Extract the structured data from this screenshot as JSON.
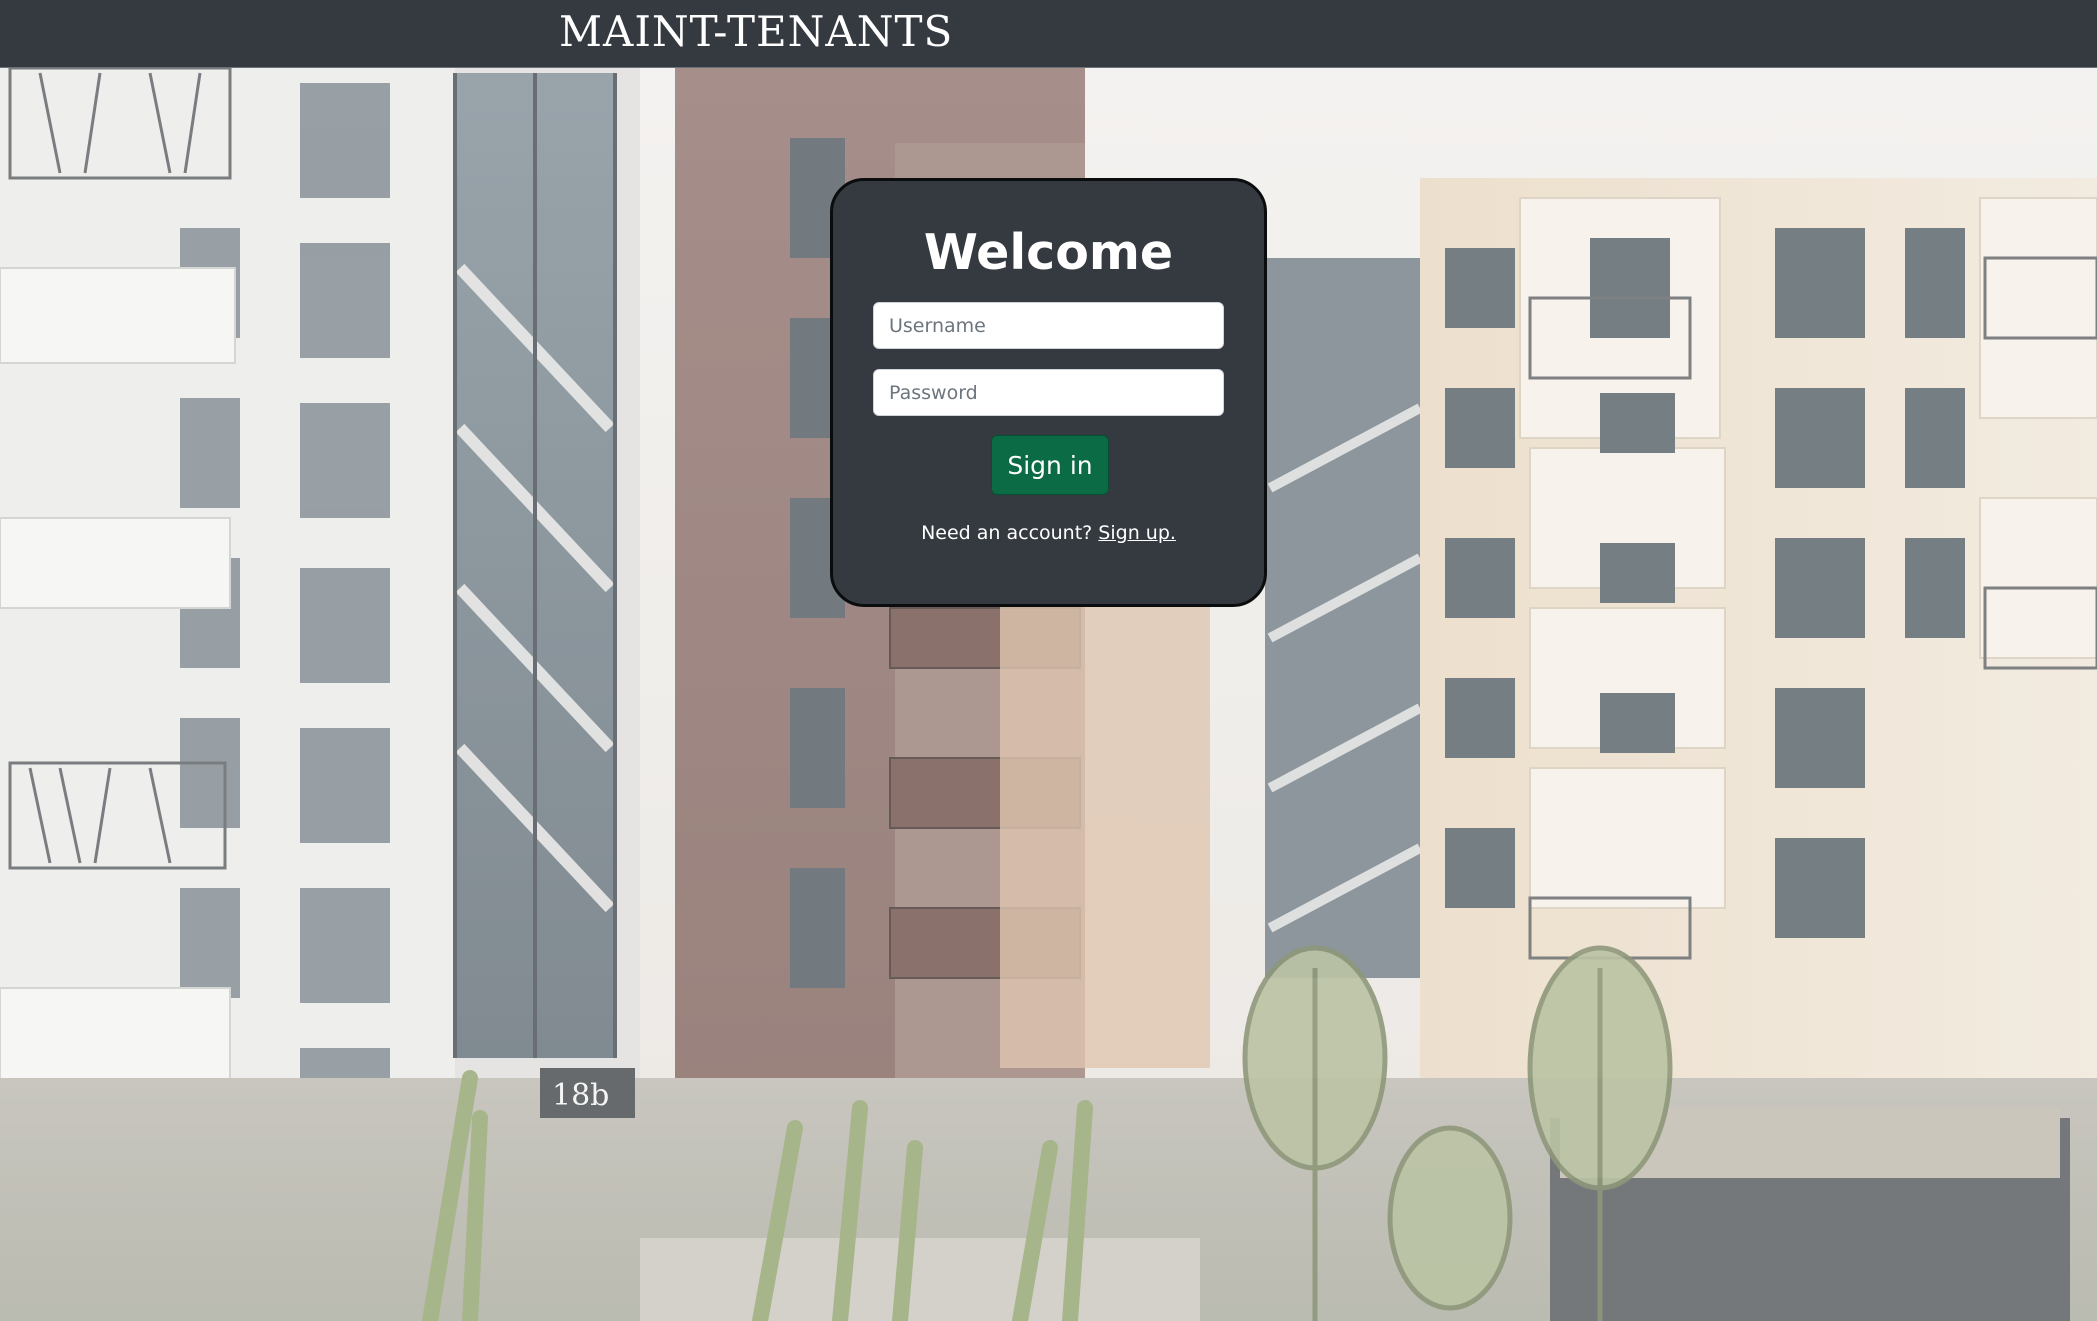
{
  "header": {
    "brand": "MAINT-TENANTS"
  },
  "background": {
    "building_number": "18b"
  },
  "login": {
    "title": "Welcome",
    "username_placeholder": "Username",
    "username_value": "",
    "password_placeholder": "Password",
    "password_value": "",
    "submit_label": "Sign in",
    "signup_prompt": "Need an account?",
    "signup_link": "Sign up."
  },
  "colors": {
    "navbar": "#343a40",
    "card": "#343a40",
    "button": "#0b6b45",
    "text": "#ffffff"
  }
}
